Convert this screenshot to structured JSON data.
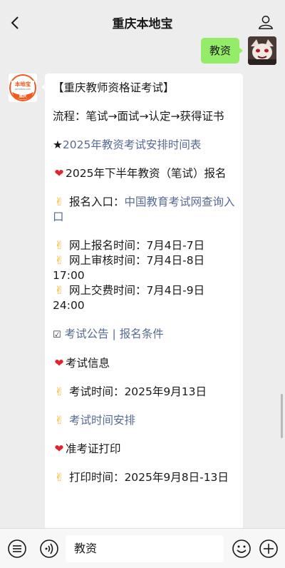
{
  "header": {
    "title": "重庆本地宝"
  },
  "user_message": {
    "text": "教资"
  },
  "bot_avatar": {
    "logo_text": "本地宝",
    "logo_subtext": "重庆",
    "logo_url_text": "bendibao.com"
  },
  "reply": {
    "title": "【重庆教师资格证考试】",
    "process": "流程：笔试→面试→认定→获得证书",
    "schedule_link": "2025年教资考试安排时间表",
    "section1_title": "2025年下半年教资（笔试）报名",
    "entry_label": "报名入口：",
    "entry_link": "中国教育考试网查询入口",
    "reg_time": "网上报名时间：7月4日-7日",
    "review_time": "网上审核时间：7月4日-8日17:00",
    "pay_time": "网上交费时间：7月4日-9日24:00",
    "notice_link": "考试公告",
    "separator": " | ",
    "conditions_link": "报名条件",
    "section2_title": "考试信息",
    "exam_time": "考试时间：2025年9月13日",
    "exam_schedule_link": "考试时间安排",
    "section3_title": "准考证打印",
    "print_time": "打印时间：2025年9月8日-13日"
  },
  "composer": {
    "input_value": "教资"
  },
  "icons": {
    "back": "chevron-left-icon",
    "profile": "person-icon",
    "menu": "menu-icon",
    "voice": "voice-icon",
    "emoji": "emoji-icon",
    "add": "plus-icon"
  },
  "colors": {
    "user_bubble": "#95ec69",
    "link": "#576b95",
    "background": "#ededed",
    "heart": "#e0242e"
  }
}
